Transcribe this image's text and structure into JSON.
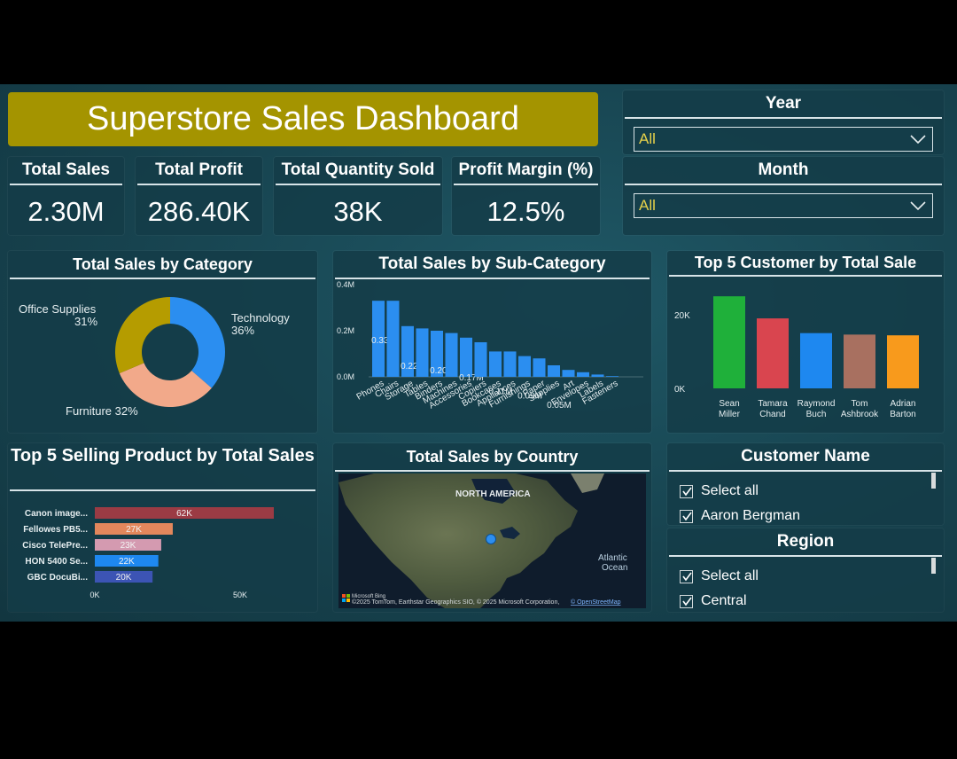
{
  "title": "Superstore Sales Dashboard",
  "kpis": [
    {
      "label": "Total Sales",
      "value": "2.30M"
    },
    {
      "label": "Total Profit",
      "value": "286.40K"
    },
    {
      "label": "Total Quantity Sold",
      "value": "38K"
    },
    {
      "label": "Profit Margin (%)",
      "value": "12.5%"
    }
  ],
  "slicers": {
    "year": {
      "label": "Year",
      "value": "All"
    },
    "month": {
      "label": "Month",
      "value": "All"
    }
  },
  "category_chart": {
    "title": "Total Sales by Category",
    "labels": [
      {
        "name": "Office Supplies",
        "pct": "31%"
      },
      {
        "name": "Technology",
        "pct": "36%"
      },
      {
        "name": "Furniture 32%"
      }
    ]
  },
  "subcat_chart": {
    "title": "Total Sales by Sub-Category"
  },
  "customer_chart": {
    "title": "Top 5 Customer by Total Sale"
  },
  "product_chart": {
    "title": "Top 5 Selling Product by Total Sales"
  },
  "map": {
    "title": "Total Sales by Country",
    "label_na": "NORTH AMERICA",
    "label_ocean_1": "Atlantic",
    "label_ocean_2": "Ocean",
    "attribution": "©2025 TomTom, Earthstar Geographics SIO, © 2025 Microsoft Corporation,",
    "attribution_link": "© OpenStreetMap",
    "bing": "Microsoft Bing"
  },
  "customer_list": {
    "title": "Customer Name",
    "items": [
      "Select all",
      "Aaron Bergman"
    ]
  },
  "region_list": {
    "title": "Region",
    "items": [
      "Select all",
      "Central"
    ]
  },
  "chart_data": [
    {
      "type": "pie",
      "title": "Total Sales by Category",
      "categories": [
        "Technology",
        "Furniture",
        "Office Supplies"
      ],
      "values": [
        36,
        32,
        31
      ],
      "colors": [
        "#2b8ef0",
        "#f2a98a",
        "#b59c00"
      ]
    },
    {
      "type": "bar",
      "title": "Total Sales by Sub-Category",
      "categories": [
        "Phones",
        "Chairs",
        "Storage",
        "Tables",
        "Binders",
        "Machines",
        "Accessories",
        "Copiers",
        "Bookcases",
        "Appliances",
        "Furnishings",
        "Paper",
        "Supplies",
        "Art",
        "Envelopes",
        "Labels",
        "Fasteners"
      ],
      "values": [
        0.33,
        0.33,
        0.22,
        0.21,
        0.2,
        0.19,
        0.17,
        0.15,
        0.11,
        0.11,
        0.09,
        0.08,
        0.05,
        0.03,
        0.02,
        0.01,
        0.003
      ],
      "data_labels": [
        "0.33M",
        "",
        "0.22M",
        "",
        "0.20M",
        "",
        "0.17M",
        "",
        "0.11M",
        "",
        "0.09M",
        "",
        "0.05M",
        "",
        "",
        "",
        ""
      ],
      "yticks": [
        "0.0M",
        "0.2M",
        "0.4M"
      ],
      "ylim": [
        0,
        0.4
      ],
      "color": "#2b8ef0"
    },
    {
      "type": "bar",
      "title": "Top 5 Customer by Total Sale",
      "categories": [
        "Sean Miller",
        "Tamara Chand",
        "Raymond Buch",
        "Tom Ashbrook",
        "Adrian Barton"
      ],
      "values": [
        25000,
        19000,
        15000,
        14600,
        14400
      ],
      "colors": [
        "#1fb03a",
        "#d9454f",
        "#1e88f0",
        "#a87060",
        "#f89a1c"
      ],
      "yticks": [
        "0K",
        "20K"
      ],
      "ylim": [
        0,
        26000
      ]
    },
    {
      "type": "bar",
      "title": "Top 5 Selling Product by Total Sales",
      "orientation": "horizontal",
      "categories": [
        "Canon image...",
        "Fellowes PB5...",
        "Cisco TelePre...",
        "HON 5400 Se...",
        "GBC DocuBi..."
      ],
      "values": [
        62,
        27,
        23,
        22,
        20
      ],
      "data_labels": [
        "62K",
        "27K",
        "23K",
        "22K",
        "20K"
      ],
      "colors": [
        "#9b3b44",
        "#e2875c",
        "#d49ab0",
        "#1e88f0",
        "#3c54b4"
      ],
      "xticks": [
        "0K",
        "50K"
      ],
      "xlim": [
        0,
        62
      ]
    }
  ]
}
